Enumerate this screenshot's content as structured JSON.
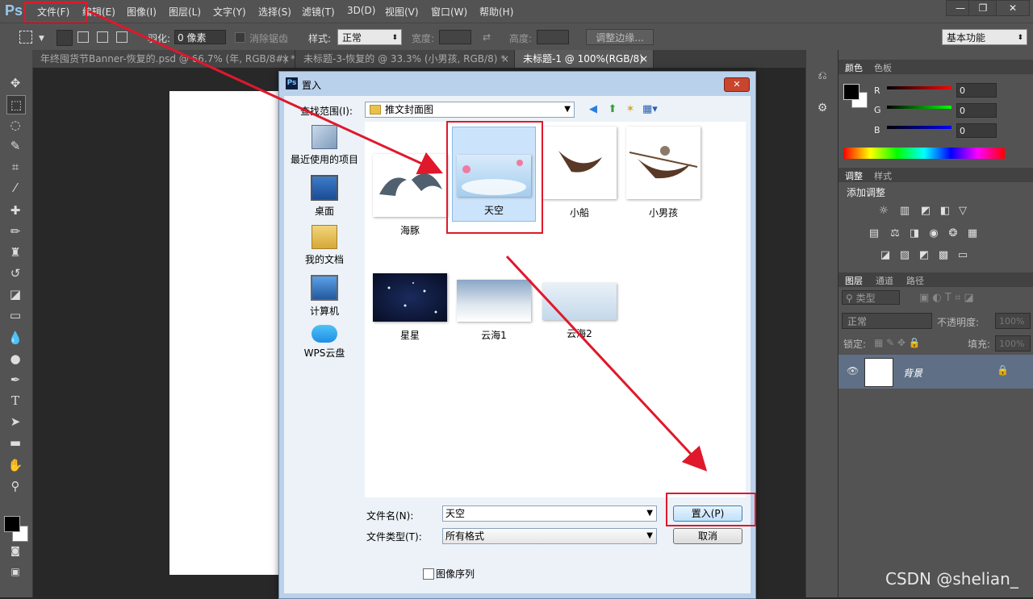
{
  "app": {
    "logo": "Ps"
  },
  "menu": [
    "文件(F)",
    "编辑(E)",
    "图像(I)",
    "图层(L)",
    "文字(Y)",
    "选择(S)",
    "滤镜(T)",
    "3D(D)",
    "视图(V)",
    "窗口(W)",
    "帮助(H)"
  ],
  "window_controls": {
    "minimize": "—",
    "restore": "❐",
    "close": "✕"
  },
  "options_bar": {
    "feather_label": "羽化:",
    "feather_value": "0 像素",
    "antialias_label": "消除锯齿",
    "style_label": "样式:",
    "style_value": "正常",
    "width_label": "宽度:",
    "height_label": "高度:",
    "refine_edge": "调整边缘...",
    "workspace": "基本功能"
  },
  "doc_tabs": [
    {
      "label": "年终囤货节Banner-恢复的.psd @ 66.7% (年, RGB/8#) *",
      "close": "×"
    },
    {
      "label": "未标题-3-恢复的 @ 33.3% (小男孩, RGB/8) *",
      "close": "×"
    },
    {
      "label": "未标题-1 @ 100%(RGB/8)",
      "close": "×"
    }
  ],
  "color_panel": {
    "tabs": [
      "颜色",
      "色板"
    ],
    "channels": [
      {
        "label": "R",
        "value": "0"
      },
      {
        "label": "G",
        "value": "0"
      },
      {
        "label": "B",
        "value": "0"
      }
    ]
  },
  "adjust_panel": {
    "tabs": [
      "调整",
      "样式"
    ],
    "title": "添加调整"
  },
  "layers_panel": {
    "tabs": [
      "图层",
      "通道",
      "路径"
    ],
    "filter_kind": "类型",
    "blend_mode": "正常",
    "opacity_label": "不透明度:",
    "opacity_value": "100%",
    "lock_label": "锁定:",
    "fill_label": "填充:",
    "fill_value": "100%",
    "layer_name": "背景"
  },
  "dialog": {
    "title": "置入",
    "ps_icon": "Ps",
    "close": "✕",
    "look_in_label": "查找范围(I):",
    "look_in_value": "推文封面图",
    "places": [
      "最近使用的项目",
      "桌面",
      "我的文档",
      "计算机",
      "WPS云盘"
    ],
    "files": [
      "海豚",
      "天空",
      "小船",
      "小男孩",
      "星星",
      "云海1",
      "云海2"
    ],
    "filename_label": "文件名(N):",
    "filename_value": "天空",
    "filetype_label": "文件类型(T):",
    "filetype_value": "所有格式",
    "place_button": "置入(P)",
    "cancel_button": "取消",
    "image_sequence": "图像序列"
  },
  "watermark": "CSDN @shelian_",
  "colors": {
    "annotation_red": "#e0182b",
    "selection_blue": "#cce4fb",
    "ui_dark": "#535353"
  }
}
